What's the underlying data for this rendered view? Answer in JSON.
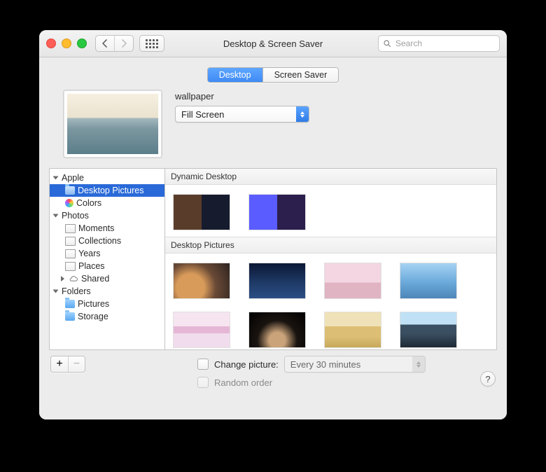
{
  "window": {
    "title": "Desktop & Screen Saver",
    "search_placeholder": "Search"
  },
  "tabs": {
    "desktop": "Desktop",
    "screensaver": "Screen Saver",
    "active": "desktop"
  },
  "preview": {
    "name_label": "wallpaper"
  },
  "fill_popup": {
    "value": "Fill Screen"
  },
  "sidebar": {
    "apple": {
      "label": "Apple",
      "items": {
        "desktop_pictures": "Desktop Pictures",
        "colors": "Colors"
      }
    },
    "photos": {
      "label": "Photos",
      "items": {
        "moments": "Moments",
        "collections": "Collections",
        "years": "Years",
        "places": "Places",
        "shared": "Shared"
      }
    },
    "folders": {
      "label": "Folders",
      "items": {
        "pictures": "Pictures",
        "storage": "Storage"
      }
    }
  },
  "content_sections": {
    "dynamic": "Dynamic Desktop",
    "pictures": "Desktop Pictures"
  },
  "bottom": {
    "change_label": "Change picture:",
    "interval_value": "Every 30 minutes",
    "random_label": "Random order",
    "help_label": "?"
  }
}
